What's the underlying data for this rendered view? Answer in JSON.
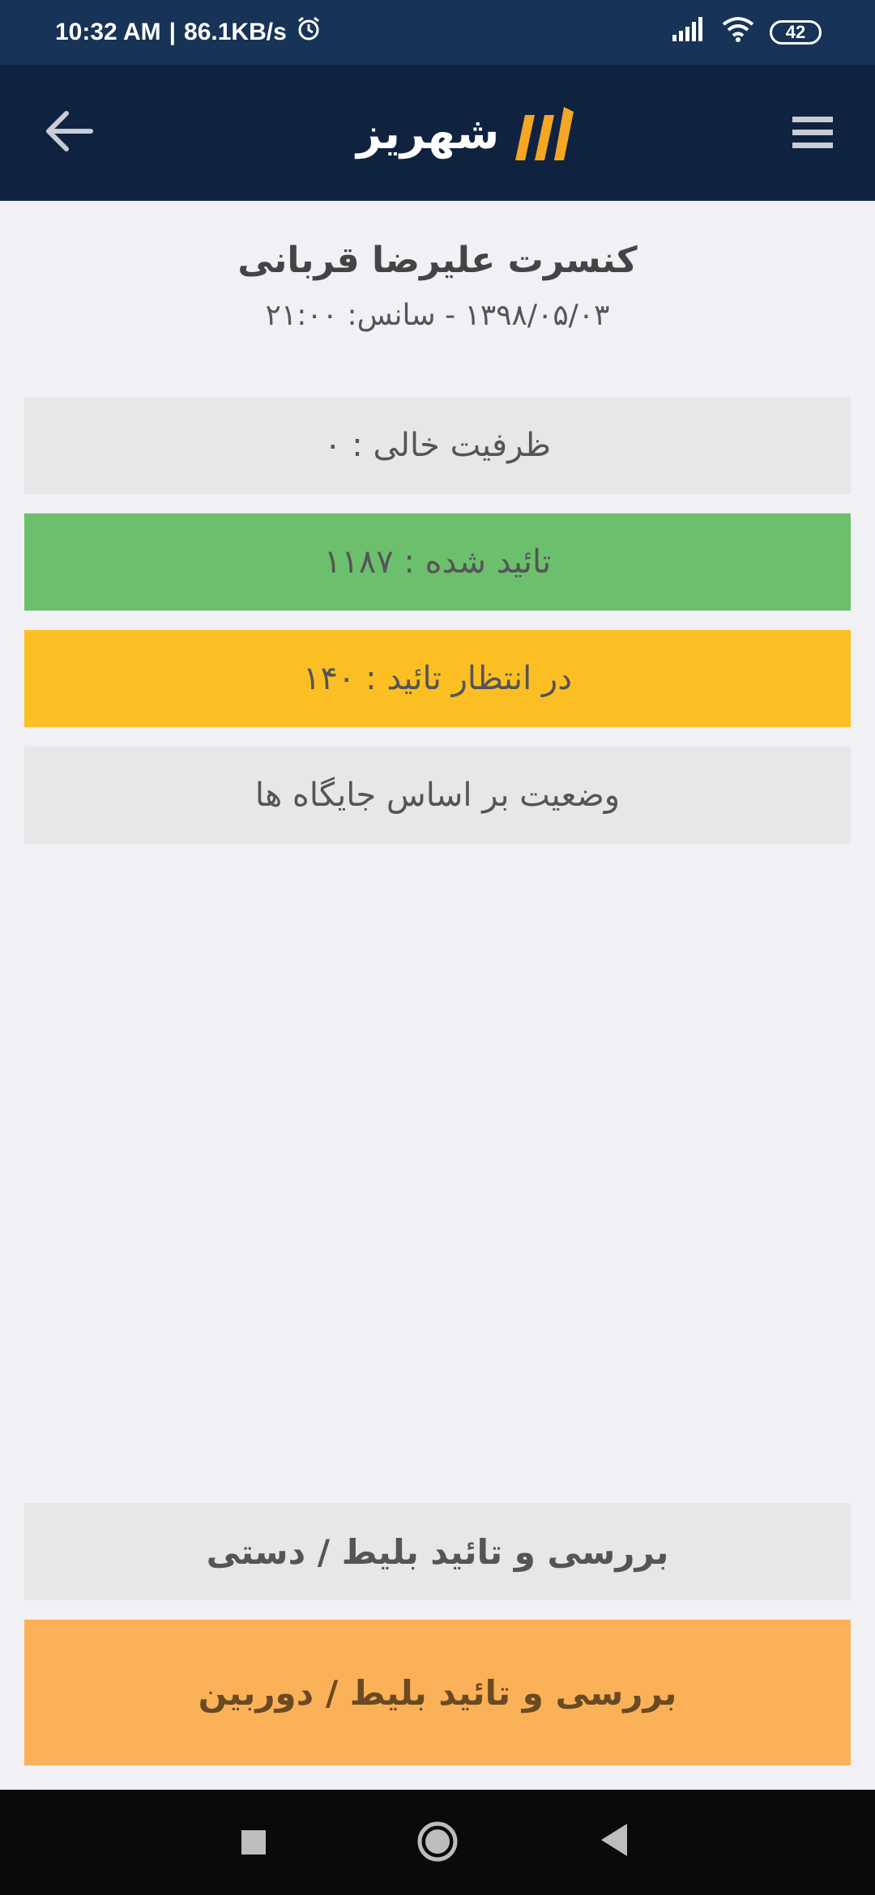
{
  "status_bar": {
    "time": "10:32 AM",
    "separator": "|",
    "speed": "86.1KB/s",
    "battery": "42",
    "icons": [
      "alarm-icon",
      "signal-icon",
      "wifi-icon",
      "battery-icon"
    ]
  },
  "app_bar": {
    "logo_text": "شهریز",
    "logo_color": "#f5a623",
    "back_icon": "arrow-left-icon",
    "menu_icon": "hamburger-icon"
  },
  "event": {
    "title": "کنسرت علیرضا قربانی",
    "subtitle": "۱۳۹۸/۰۵/۰۳ - سانس:  ۲۱:۰۰"
  },
  "stats": {
    "capacity": "ظرفیت خالی : ۰",
    "confirmed": "تائید شده : ۱۱۸۷",
    "pending": "در انتظار تائید : ۱۴۰",
    "seat_status": "وضعیت بر اساس جایگاه ها"
  },
  "actions": {
    "manual": "بررسی و تائید بلیط / دستی",
    "camera": "بررسی و تائید بلیط / دوربین"
  },
  "colors": {
    "status_bar": "#173357",
    "app_bar": "#0f2340",
    "confirmed": "#6cc06d",
    "pending": "#fbbf24",
    "camera_button": "#fbb157",
    "neutral_row": "#e7e7e7"
  }
}
